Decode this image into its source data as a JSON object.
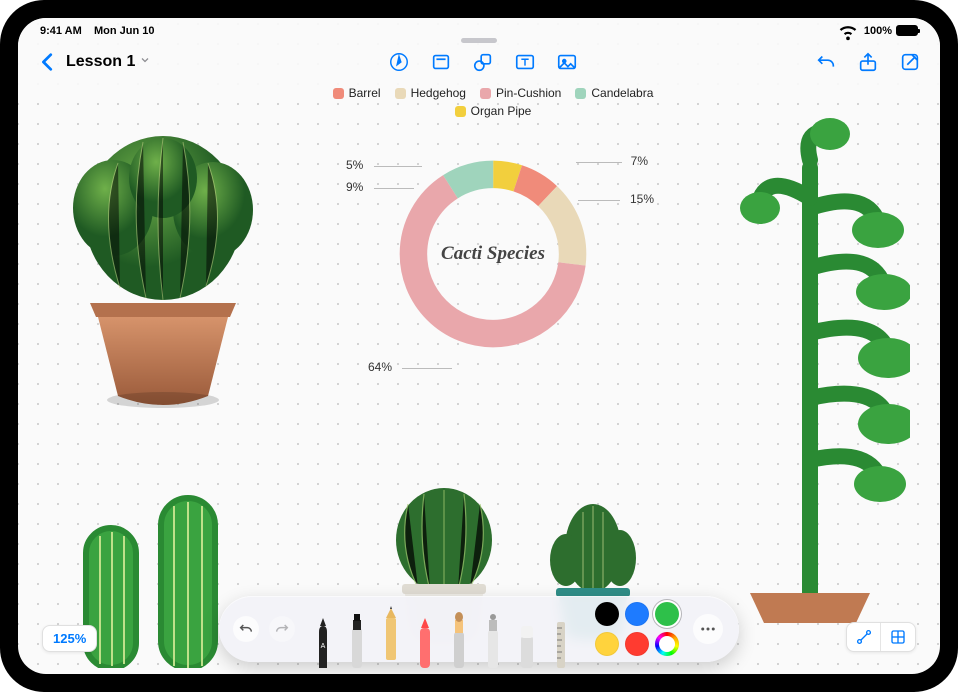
{
  "statusbar": {
    "time": "9:41 AM",
    "date": "Mon Jun 10",
    "battery": "100%"
  },
  "nav": {
    "title": "Lesson 1",
    "tools": {
      "back": "Back",
      "draw": "Drawing Tools",
      "sticky": "Sticky Note",
      "shape": "Shapes",
      "text": "Text Box",
      "media": "Media",
      "undo": "Undo",
      "share": "Share",
      "compose": "More"
    }
  },
  "zoom": {
    "label": "125%"
  },
  "bottomRight": {
    "shapes": "Connectors",
    "grid": "Grid"
  },
  "drawbar": {
    "undo": "Undo",
    "redo": "Redo",
    "more": "More",
    "tools": [
      "Pen",
      "Marker",
      "Pencil",
      "Crayon",
      "Watercolor",
      "Airbrush",
      "Eraser",
      "Ruler"
    ],
    "colors": [
      {
        "name": "black",
        "hex": "#000000"
      },
      {
        "name": "blue",
        "hex": "#1e7bff"
      },
      {
        "name": "green",
        "hex": "#2ec04a"
      },
      {
        "name": "yellow",
        "hex": "#ffd33d"
      },
      {
        "name": "red",
        "hex": "#ff3b30"
      },
      {
        "name": "picker",
        "hex": "picker"
      }
    ],
    "selected_color": "green"
  },
  "chart_data": {
    "type": "pie",
    "title": "Cacti Species",
    "series": [
      {
        "name": "Barrel",
        "value": 7,
        "color": "#f08b7a"
      },
      {
        "name": "Hedgehog",
        "value": 15,
        "color": "#e9d9b8"
      },
      {
        "name": "Pin-Cushion",
        "value": 64,
        "color": "#e9a7ab"
      },
      {
        "name": "Candelabra",
        "value": 9,
        "color": "#9fd4bc"
      },
      {
        "name": "Organ Pipe",
        "value": 5,
        "color": "#f2cf3d"
      }
    ],
    "labels": [
      "7%",
      "15%",
      "64%",
      "9%",
      "5%"
    ]
  },
  "plants": {
    "p1": "Barrel cactus in clay pot (photo, top left)",
    "p2": "Small cactus in white pot (photo, bottom center-left)",
    "p3": "Small cactus in teal pot (photo, bottom center-right)",
    "p4": "Tall candelabra cactus drawing (right side, green marker)",
    "p5": "Columnar cactus drawing (bottom left, green marker)",
    "p6": "Potted drawing base (bottom right)"
  }
}
